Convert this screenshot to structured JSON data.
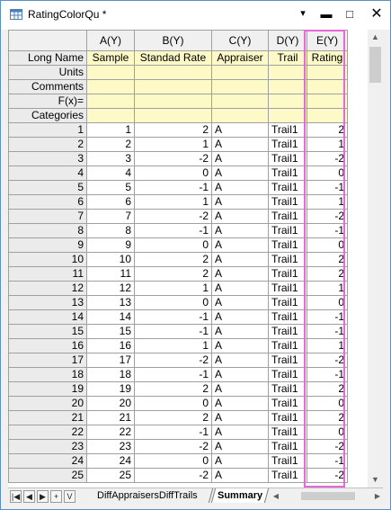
{
  "window": {
    "title": "RatingColorQu *",
    "menu_glyph": "▾",
    "min_glyph": "▬",
    "max_glyph": "□",
    "close_glyph": "✕",
    "icon": "worksheet-grid-icon"
  },
  "columns": [
    {
      "name": "A(Y)",
      "long_name": "Sample"
    },
    {
      "name": "B(Y)",
      "long_name": "Standad Rate"
    },
    {
      "name": "C(Y)",
      "long_name": "Appraiser"
    },
    {
      "name": "D(Y)",
      "long_name": "Trail"
    },
    {
      "name": "E(Y)",
      "long_name": "Rating"
    }
  ],
  "row_labels": {
    "long_name": "Long Name",
    "units": "Units",
    "comments": "Comments",
    "fx": "F(x)=",
    "categories": "Categories"
  },
  "rows": [
    [
      "1",
      "1",
      "2",
      "A",
      "Trail1",
      "2"
    ],
    [
      "2",
      "2",
      "1",
      "A",
      "Trail1",
      "1"
    ],
    [
      "3",
      "3",
      "-2",
      "A",
      "Trail1",
      "-2"
    ],
    [
      "4",
      "4",
      "0",
      "A",
      "Trail1",
      "0"
    ],
    [
      "5",
      "5",
      "-1",
      "A",
      "Trail1",
      "-1"
    ],
    [
      "6",
      "6",
      "1",
      "A",
      "Trail1",
      "1"
    ],
    [
      "7",
      "7",
      "-2",
      "A",
      "Trail1",
      "-2"
    ],
    [
      "8",
      "8",
      "-1",
      "A",
      "Trail1",
      "-1"
    ],
    [
      "9",
      "9",
      "0",
      "A",
      "Trail1",
      "0"
    ],
    [
      "10",
      "10",
      "2",
      "A",
      "Trail1",
      "2"
    ],
    [
      "11",
      "11",
      "2",
      "A",
      "Trail1",
      "2"
    ],
    [
      "12",
      "12",
      "1",
      "A",
      "Trail1",
      "1"
    ],
    [
      "13",
      "13",
      "0",
      "A",
      "Trail1",
      "0"
    ],
    [
      "14",
      "14",
      "-1",
      "A",
      "Trail1",
      "-1"
    ],
    [
      "15",
      "15",
      "-1",
      "A",
      "Trail1",
      "-1"
    ],
    [
      "16",
      "16",
      "1",
      "A",
      "Trail1",
      "1"
    ],
    [
      "17",
      "17",
      "-2",
      "A",
      "Trail1",
      "-2"
    ],
    [
      "18",
      "18",
      "-1",
      "A",
      "Trail1",
      "-1"
    ],
    [
      "19",
      "19",
      "2",
      "A",
      "Trail1",
      "2"
    ],
    [
      "20",
      "20",
      "0",
      "A",
      "Trail1",
      "0"
    ],
    [
      "21",
      "21",
      "2",
      "A",
      "Trail1",
      "2"
    ],
    [
      "22",
      "22",
      "-1",
      "A",
      "Trail1",
      "0"
    ],
    [
      "23",
      "23",
      "-2",
      "A",
      "Trail1",
      "-2"
    ],
    [
      "24",
      "24",
      "0",
      "A",
      "Trail1",
      "-1"
    ],
    [
      "25",
      "25",
      "-2",
      "A",
      "Trail1",
      "-2"
    ]
  ],
  "nav": {
    "first": "|◀",
    "prev": "◀",
    "next": "▶",
    "add": "+",
    "menu": "V"
  },
  "sheets": {
    "tab1": "DiffAppraisersDiffTrails",
    "tab2": "Summary",
    "active": "Summary"
  },
  "colors": {
    "meta_row_bg": "#fdfac8",
    "selection_outline": "#e868d8",
    "header_bg": "#f0f0f0"
  }
}
